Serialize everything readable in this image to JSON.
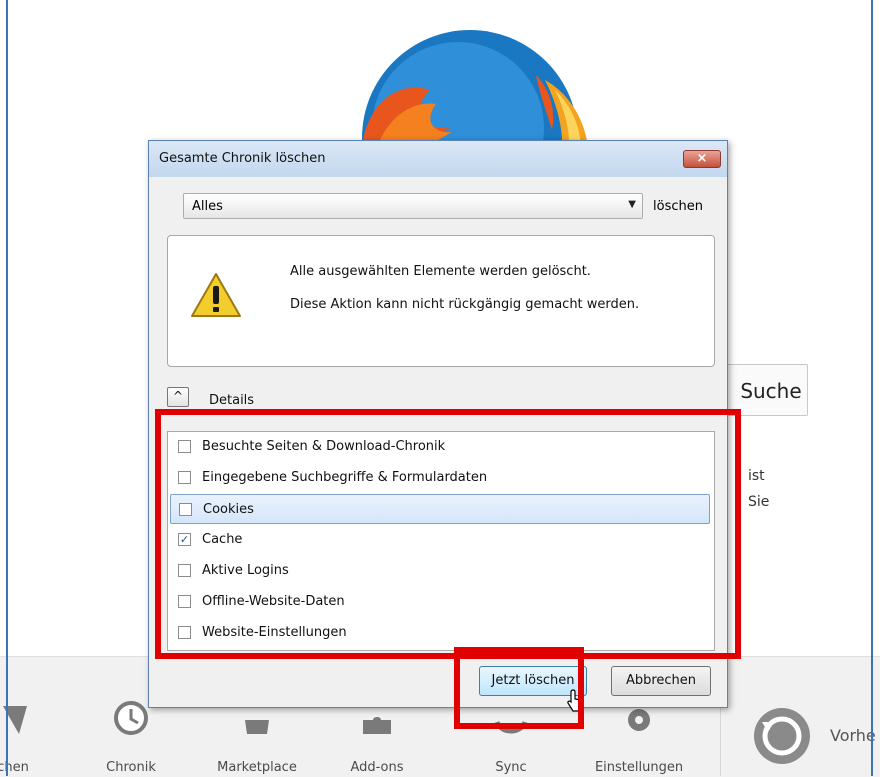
{
  "background": {
    "search_button": "Suche",
    "text_fragment_1": "ist",
    "text_fragment_2": "Sie",
    "launchers": [
      {
        "label": "chen",
        "icon": "bookmark-icon"
      },
      {
        "label": "Chronik",
        "icon": "clock-icon"
      },
      {
        "label": "Marketplace",
        "icon": "marketplace-icon"
      },
      {
        "label": "Add-ons",
        "icon": "puzzle-icon"
      },
      {
        "label": "Sync",
        "icon": "sync-icon"
      },
      {
        "label": "Einstellungen",
        "icon": "gear-icon"
      }
    ],
    "restore_label": "Vorhe"
  },
  "dialog": {
    "title": "Gesamte Chronik löschen",
    "close_icon": "x-icon",
    "range_value": "Alles",
    "range_suffix": "löschen",
    "warning_line1": "Alle ausgewählten Elemente werden gelöscht.",
    "warning_line2": "Diese Aktion kann nicht rückgängig gemacht werden.",
    "details_label": "Details",
    "details_toggle_glyph": "^",
    "items": [
      {
        "label": "Besuchte Seiten & Download-Chronik",
        "checked": false
      },
      {
        "label": "Eingegebene Suchbegriffe & Formulardaten",
        "checked": false
      },
      {
        "label": "Cookies",
        "checked": false,
        "selected": true
      },
      {
        "label": "Cache",
        "checked": true
      },
      {
        "label": "Aktive Logins",
        "checked": false
      },
      {
        "label": "Offline-Website-Daten",
        "checked": false
      },
      {
        "label": "Website-Einstellungen",
        "checked": false
      }
    ],
    "ok_button": "Jetzt löschen",
    "cancel_button": "Abbrechen"
  },
  "colors": {
    "highlight": "#e10000",
    "accent": "#3b73b9"
  }
}
